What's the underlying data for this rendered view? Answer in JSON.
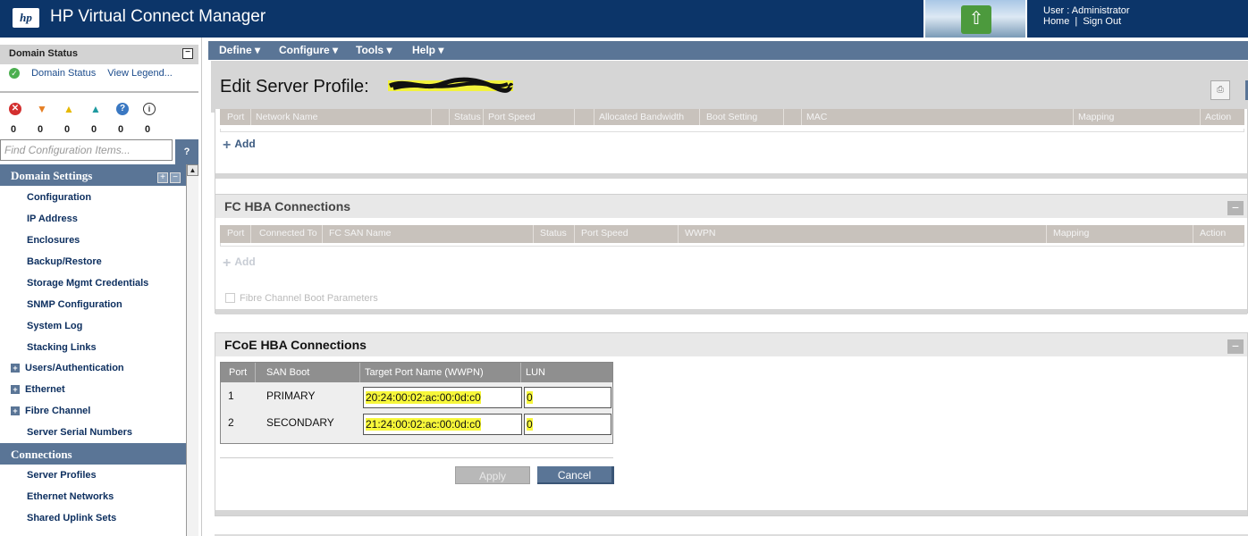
{
  "header": {
    "logo_text": "hp",
    "title": "HP Virtual Connect Manager",
    "user_label": "User : Administrator",
    "home": "Home",
    "separator": "|",
    "sign_out": "Sign Out"
  },
  "sidebar": {
    "domain_status_title": "Domain Status",
    "domain_status_link": "Domain Status",
    "view_legend_link": "View Legend...",
    "collapse_glyph": "−",
    "status_counts": [
      "0",
      "0",
      "0",
      "0",
      "0",
      "0"
    ],
    "find_placeholder": "Find Configuration Items...",
    "find_help": "?",
    "domain_settings_header": "Domain Settings",
    "domain_settings_items": [
      "Configuration",
      "IP Address",
      "Enclosures",
      "Backup/Restore",
      "Storage Mgmt Credentials",
      "SNMP Configuration",
      "System Log",
      "Stacking Links"
    ],
    "expandable_items": [
      "Users/Authentication",
      "Ethernet",
      "Fibre Channel"
    ],
    "server_serial_numbers": "Server Serial Numbers",
    "connections_header": "Connections",
    "connections_items": [
      "Server Profiles",
      "Ethernet Networks",
      "Shared Uplink Sets"
    ]
  },
  "menubar": {
    "define": "Define ▾",
    "configure": "Configure ▾",
    "tools": "Tools ▾",
    "help": "Help ▾"
  },
  "page": {
    "title": "Edit Server Profile:"
  },
  "ethernet_panel": {
    "columns": [
      "Port",
      "Network Name",
      "Status",
      "Port Speed",
      "Allocated Bandwidth",
      "Boot Setting",
      "MAC",
      "Mapping",
      "Action"
    ],
    "add_label": "Add"
  },
  "fc_panel": {
    "title": "FC HBA Connections",
    "columns": [
      "Port",
      "Connected To",
      "FC SAN Name",
      "Status",
      "Port Speed",
      "WWPN",
      "Mapping",
      "Action"
    ],
    "add_label": "Add",
    "boot_params_label": "Fibre Channel Boot Parameters"
  },
  "fcoe_panel": {
    "title": "FCoE HBA Connections",
    "columns": [
      "Port",
      "SAN Boot",
      "Target Port Name (WWPN)",
      "LUN"
    ],
    "rows": [
      {
        "port": "1",
        "san_boot": "PRIMARY",
        "wwpn": "20:24:00:02:ac:00:0d:c0",
        "lun": "0"
      },
      {
        "port": "2",
        "san_boot": "SECONDARY",
        "wwpn": "21:24:00:02:ac:00:0d:c0",
        "lun": "0"
      }
    ],
    "apply_label": "Apply",
    "cancel_label": "Cancel"
  }
}
